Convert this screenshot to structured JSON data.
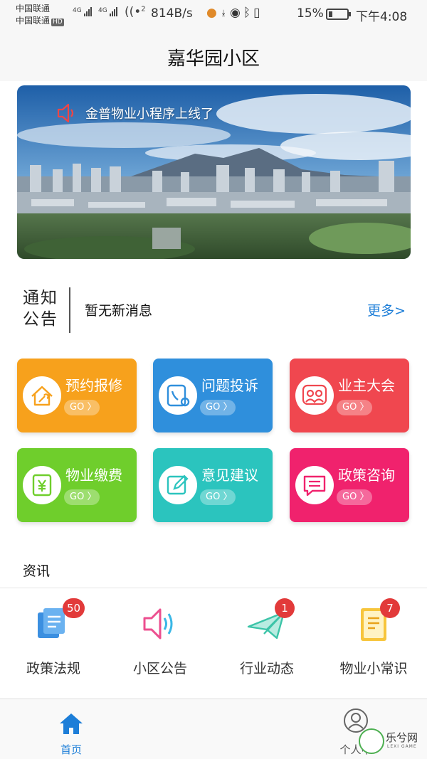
{
  "status_bar": {
    "carrier_1": "中国联通",
    "carrier_2": "中国联通",
    "hd": "HD",
    "net_1": "4G",
    "net_2": "4G",
    "wifi_sup": "2",
    "speed": "814B/s",
    "battery": "15%",
    "time": "下午4:08"
  },
  "header": {
    "title": "嘉华园小区"
  },
  "banner": {
    "text": "金普物业小程序上线了"
  },
  "notice": {
    "label": "通知公告",
    "message": "暂无新消息",
    "more": "更多>"
  },
  "services": [
    {
      "label": "预约报修",
      "go": "GO 〉",
      "icon": "house-wrench-icon",
      "color": "#f7a11c"
    },
    {
      "label": "问题投诉",
      "go": "GO 〉",
      "icon": "phone-gear-icon",
      "color": "#2f8fdc"
    },
    {
      "label": "业主大会",
      "go": "GO 〉",
      "icon": "people-icon",
      "color": "#f0474f"
    },
    {
      "label": "物业缴费",
      "go": "GO 〉",
      "icon": "yuan-icon",
      "color": "#6fce2c"
    },
    {
      "label": "意见建议",
      "go": "GO 〉",
      "icon": "edit-icon",
      "color": "#2bc4be"
    },
    {
      "label": "政策咨询",
      "go": "GO 〉",
      "icon": "chat-icon",
      "color": "#f0226d"
    }
  ],
  "news": {
    "title": "资讯",
    "items": [
      {
        "label": "政策法规",
        "badge": "50",
        "icon": "documents-icon"
      },
      {
        "label": "小区公告",
        "badge": "",
        "icon": "speaker-icon"
      },
      {
        "label": "行业动态",
        "badge": "1",
        "icon": "paper-plane-icon"
      },
      {
        "label": "物业小常识",
        "badge": "7",
        "icon": "book-icon"
      }
    ]
  },
  "bottom_nav": {
    "home": "首页",
    "me": "个人中"
  },
  "watermark": {
    "text": "乐兮网",
    "sub": "LEXI GAME"
  }
}
